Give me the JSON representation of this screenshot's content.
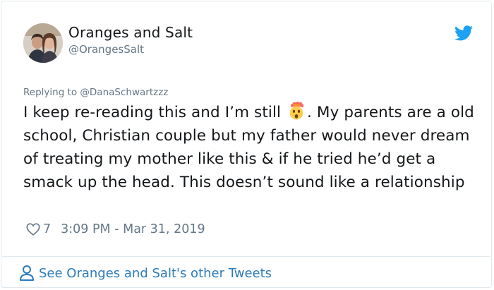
{
  "author": {
    "display_name": "Oranges and Salt",
    "handle": "@OrangesSalt"
  },
  "reply_to": {
    "prefix": "Replying to",
    "mention": "@DanaSchwartzzz"
  },
  "tweet": {
    "text_before_emoji": "I keep re-reading this and I’m still",
    "emoji_name": "exploding-head-emoji",
    "text_after_emoji": ". My parents are a old school, Christian couple but my father would never dream of treating my mother like this & if he tried he’d get a smack up the head. This doesn’t sound like a relationship"
  },
  "meta": {
    "like_count": "7",
    "timestamp": "3:09 PM - Mar 31, 2019"
  },
  "footer": {
    "link_text": "See Oranges and Salt's other Tweets"
  },
  "colors": {
    "twitter_blue": "#1da1f2",
    "link_blue": "#2b7bb9",
    "text_primary": "#14171a",
    "text_secondary": "#657786",
    "border": "#e1e8ed"
  },
  "icons": [
    "avatar",
    "twitter-bird-icon",
    "heart-icon",
    "person-icon",
    "exploding-head-emoji"
  ]
}
